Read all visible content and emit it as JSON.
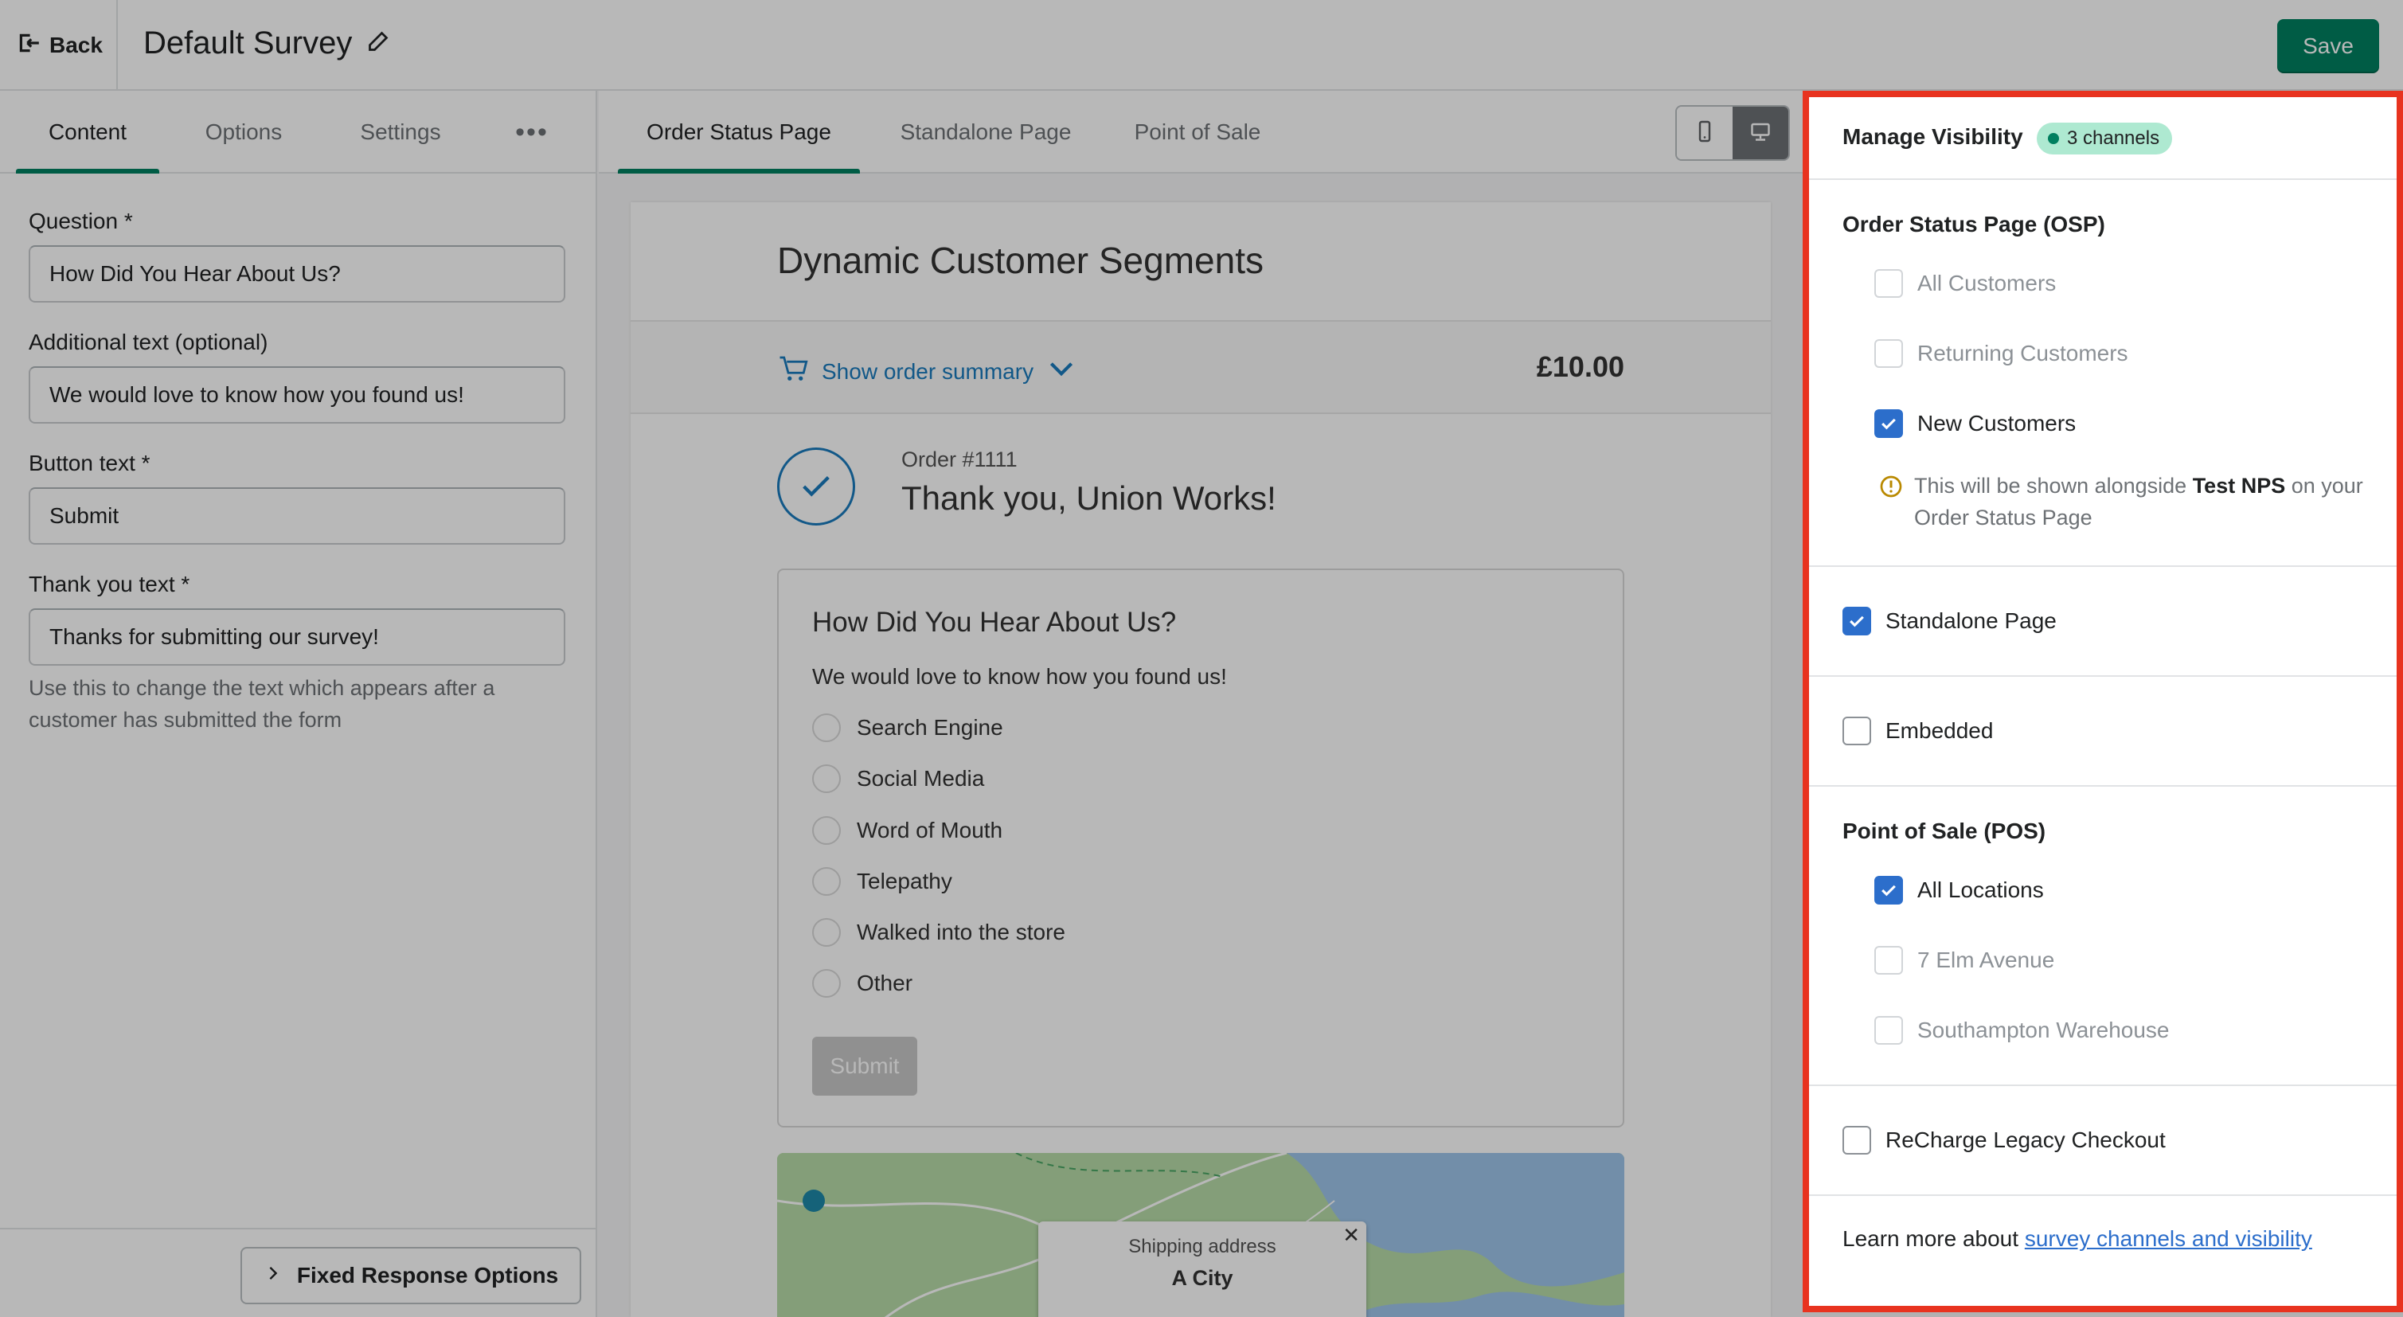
{
  "topbar": {
    "back_label": "Back",
    "survey_title": "Default Survey",
    "save_label": "Save"
  },
  "left": {
    "tabs": [
      {
        "label": "Content",
        "active": true
      },
      {
        "label": "Options",
        "active": false
      },
      {
        "label": "Settings",
        "active": false
      }
    ],
    "more_label": "•••",
    "fields": [
      {
        "label": "Question *",
        "value": "How Did You Hear About Us?"
      },
      {
        "label": "Additional text (optional)",
        "value": "We would love to know how you found us!"
      },
      {
        "label": "Button text *",
        "value": "Submit"
      },
      {
        "label": "Thank you text *",
        "value": "Thanks for submitting our survey!"
      }
    ],
    "help_text": "Use this to change the text which appears after a customer has submitted the form",
    "fixed_button_label": "Fixed Response Options"
  },
  "preview": {
    "tabs": [
      {
        "label": "Order Status Page",
        "active": true
      },
      {
        "label": "Standalone Page",
        "active": false
      },
      {
        "label": "Point of Sale",
        "active": false
      }
    ],
    "device_buttons": [
      {
        "icon": "mobile-icon",
        "active": false
      },
      {
        "icon": "desktop-icon",
        "active": true
      }
    ],
    "store_name": "Dynamic Customer Segments",
    "summary_label": "Show order summary",
    "price": "£10.00",
    "order_number": "Order #1111",
    "thanks": "Thank you, Union Works!",
    "survey": {
      "title": "How Did You Hear About Us?",
      "subtitle": "We would love to know how you found us!",
      "options": [
        "Search Engine",
        "Social Media",
        "Word of Mouth",
        "Telepathy",
        "Walked into the store",
        "Other"
      ],
      "submit_label": "Submit"
    },
    "map": {
      "popup_label": "Shipping address",
      "popup_city": "A City",
      "close": "✕"
    }
  },
  "visibility": {
    "title": "Manage Visibility",
    "badge": "3 channels",
    "osp": {
      "title": "Order Status Page (OSP)",
      "options": [
        {
          "label": "All Customers",
          "checked": false,
          "disabled": true
        },
        {
          "label": "Returning Customers",
          "checked": false,
          "disabled": true
        },
        {
          "label": "New Customers",
          "checked": true,
          "disabled": false
        }
      ],
      "warning_prefix": "This will be shown alongside ",
      "warning_bold": "Test NPS",
      "warning_suffix": " on your Order Status Page"
    },
    "standalone": {
      "label": "Standalone Page",
      "checked": true
    },
    "embedded": {
      "label": "Embedded",
      "checked": false
    },
    "pos": {
      "title": "Point of Sale (POS)",
      "options": [
        {
          "label": "All Locations",
          "checked": true,
          "disabled": false
        },
        {
          "label": "7 Elm Avenue",
          "checked": false,
          "disabled": true
        },
        {
          "label": "Southampton Warehouse",
          "checked": false,
          "disabled": true
        }
      ]
    },
    "recharge": {
      "label": "ReCharge Legacy Checkout",
      "checked": false
    },
    "learn_prefix": "Learn more about ",
    "learn_link": "survey channels and visibility"
  },
  "colors": {
    "primary": "#008060",
    "checkbox": "#2c6ecb",
    "badge_bg": "#aee9d1",
    "highlight": "#e8331f",
    "link": "#197bbd"
  }
}
